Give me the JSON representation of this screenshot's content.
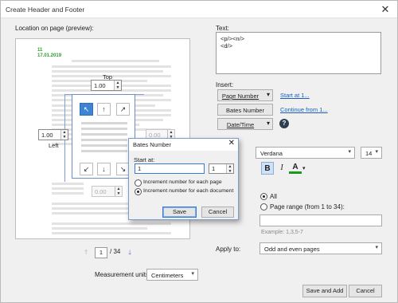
{
  "window": {
    "title": "Create Header and Footer"
  },
  "preview": {
    "label": "Location on page (preview):",
    "header_line1": "11",
    "header_line2": "17.01.2019",
    "top_label": "Top",
    "top_value": "1.00",
    "left_label": "Left",
    "left_value": "1.00",
    "right_value": "0.00",
    "bottom_value": "0.00",
    "current_page": "1",
    "total_pages": "/ 34"
  },
  "measurement": {
    "label": "Measurement units:",
    "value": "Centimeters"
  },
  "text_section": {
    "label": "Text:",
    "lines": [
      "<p/><n/>",
      "<d/>"
    ]
  },
  "insert": {
    "label": "Insert:",
    "page_number": "Page Number",
    "bates_number": "Bates Number",
    "date_time": "Date/Time",
    "start_at_link": "Start at 1...",
    "continue_from_link": "Continue from 1..."
  },
  "font": {
    "name": "Verdana",
    "size": "14",
    "bold": "B",
    "italic": "I",
    "color_letter": "A",
    "color": "#1a9a1a"
  },
  "pages": {
    "all_label": "All",
    "range_label": "Page range (from 1 to 34):",
    "range_value": "",
    "example": "Example: 1,3,5-7"
  },
  "apply_to": {
    "label": "Apply to:",
    "value": "Odd and even pages"
  },
  "footer_buttons": {
    "save_add": "Save and Add",
    "cancel": "Cancel"
  },
  "bates_dialog": {
    "title": "Bates Number",
    "start_label": "Start at:",
    "start_value": "1",
    "digits_value": "1",
    "option1": "Increment number for each page",
    "option2": "Increment number for each document",
    "selected_option": 2,
    "save": "Save",
    "cancel": "Cancel"
  }
}
